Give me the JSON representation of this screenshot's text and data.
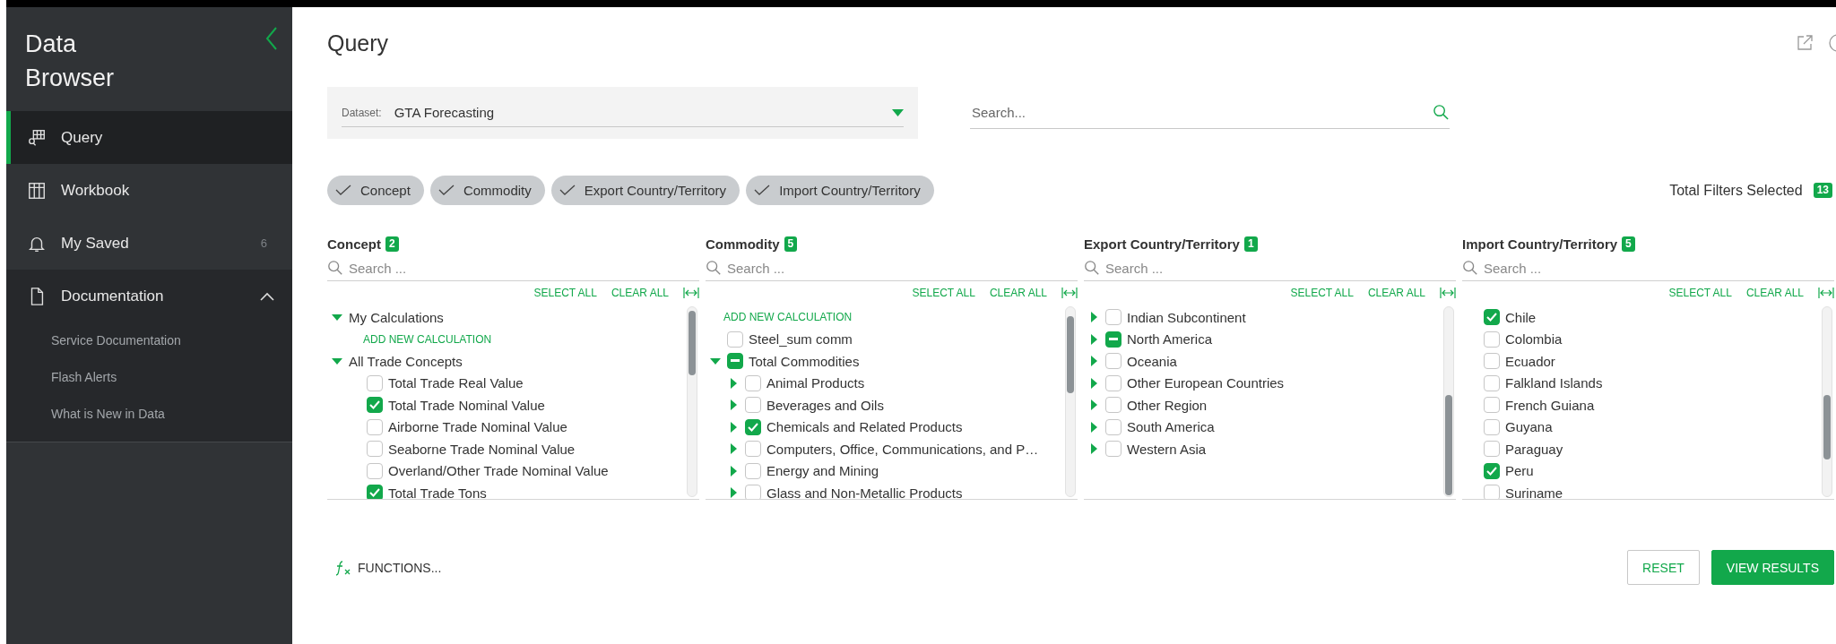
{
  "sidebar": {
    "title": "Data Browser",
    "items": [
      {
        "label": "Query",
        "selected": true
      },
      {
        "label": "Workbook",
        "selected": false
      },
      {
        "label": "My Saved",
        "selected": false,
        "count": "6"
      },
      {
        "label": "Documentation",
        "selected": false,
        "expanded": true,
        "children": [
          {
            "label": "Service Documentation"
          },
          {
            "label": "Flash Alerts"
          },
          {
            "label": "What is New in Data"
          }
        ]
      }
    ]
  },
  "page": {
    "title": "Query"
  },
  "dataset": {
    "label": "Dataset:",
    "value": "GTA Forecasting"
  },
  "search": {
    "placeholder": "Search..."
  },
  "chips": [
    {
      "label": "Concept",
      "checked": true
    },
    {
      "label": "Commodity",
      "checked": true
    },
    {
      "label": "Export Country/Territory",
      "checked": true
    },
    {
      "label": "Import Country/Territory",
      "checked": true
    }
  ],
  "total_filters": {
    "label": "Total Filters Selected",
    "count": "13"
  },
  "columns": [
    {
      "title": "Concept",
      "count": "2",
      "search_placeholder": "Search ...",
      "select_all": "SELECT ALL",
      "clear_all": "CLEAR ALL",
      "items": [
        {
          "kind": "group",
          "label": "My Calculations",
          "expanded": true,
          "children": [
            {
              "kind": "action",
              "label": "ADD NEW CALCULATION"
            }
          ]
        },
        {
          "kind": "group",
          "label": "All Trade Concepts",
          "expanded": true,
          "children": [
            {
              "kind": "option",
              "label": "Total Trade Real Value",
              "checked": false
            },
            {
              "kind": "option",
              "label": "Total Trade Nominal Value",
              "checked": true
            },
            {
              "kind": "option",
              "label": "Airborne Trade Nominal Value",
              "checked": false
            },
            {
              "kind": "option",
              "label": "Seaborne Trade Nominal Value",
              "checked": false
            },
            {
              "kind": "option",
              "label": "Overland/Other Trade Nominal Value",
              "checked": false
            },
            {
              "kind": "option",
              "label": "Total Trade Tons",
              "checked": true
            }
          ]
        }
      ]
    },
    {
      "title": "Commodity",
      "count": "5",
      "search_placeholder": "Search ...",
      "select_all": "SELECT ALL",
      "clear_all": "CLEAR ALL",
      "items": [
        {
          "kind": "action",
          "label": "ADD NEW CALCULATION"
        },
        {
          "kind": "option",
          "label": "Steel_sum comm",
          "checked": false
        },
        {
          "kind": "node",
          "label": "Total Commodities",
          "expanded": true,
          "partial": true,
          "children": [
            {
              "kind": "node",
              "label": "Animal Products",
              "expanded": false,
              "checked": false
            },
            {
              "kind": "node",
              "label": "Beverages and Oils",
              "expanded": false,
              "checked": false
            },
            {
              "kind": "node",
              "label": "Chemicals and Related Products",
              "expanded": false,
              "checked": true
            },
            {
              "kind": "node",
              "label": "Computers, Office, Communications, and P…",
              "expanded": false,
              "checked": false
            },
            {
              "kind": "node",
              "label": "Energy and Mining",
              "expanded": false,
              "checked": false
            },
            {
              "kind": "node",
              "label": "Glass and Non-Metallic Products",
              "expanded": false,
              "checked": false
            }
          ]
        }
      ]
    },
    {
      "title": "Export Country/Territory",
      "count": "1",
      "search_placeholder": "Search ...",
      "select_all": "SELECT ALL",
      "clear_all": "CLEAR ALL",
      "items": [
        {
          "kind": "node",
          "label": "Indian Subcontinent",
          "expanded": false,
          "checked": false
        },
        {
          "kind": "node",
          "label": "North America",
          "expanded": false,
          "partial": true
        },
        {
          "kind": "node",
          "label": "Oceania",
          "expanded": false,
          "checked": false
        },
        {
          "kind": "node",
          "label": "Other European Countries",
          "expanded": false,
          "checked": false
        },
        {
          "kind": "node",
          "label": "Other Region",
          "expanded": false,
          "checked": false
        },
        {
          "kind": "node",
          "label": "South America",
          "expanded": false,
          "checked": false
        },
        {
          "kind": "node",
          "label": "Western Asia",
          "expanded": false,
          "checked": false
        }
      ]
    },
    {
      "title": "Import Country/Territory",
      "count": "5",
      "search_placeholder": "Search ...",
      "select_all": "SELECT ALL",
      "clear_all": "CLEAR ALL",
      "items": [
        {
          "kind": "option",
          "label": "Chile",
          "checked": true
        },
        {
          "kind": "option",
          "label": "Colombia",
          "checked": false
        },
        {
          "kind": "option",
          "label": "Ecuador",
          "checked": false
        },
        {
          "kind": "option",
          "label": "Falkland Islands",
          "checked": false
        },
        {
          "kind": "option",
          "label": "French Guiana",
          "checked": false
        },
        {
          "kind": "option",
          "label": "Guyana",
          "checked": false
        },
        {
          "kind": "option",
          "label": "Paraguay",
          "checked": false
        },
        {
          "kind": "option",
          "label": "Peru",
          "checked": true
        },
        {
          "kind": "option",
          "label": "Suriname",
          "checked": false
        }
      ]
    }
  ],
  "functions": {
    "label": "FUNCTIONS..."
  },
  "buttons": [
    {
      "label": "RESET",
      "kind": "secondary"
    },
    {
      "label": "VIEW RESULTS",
      "kind": "primary"
    }
  ]
}
